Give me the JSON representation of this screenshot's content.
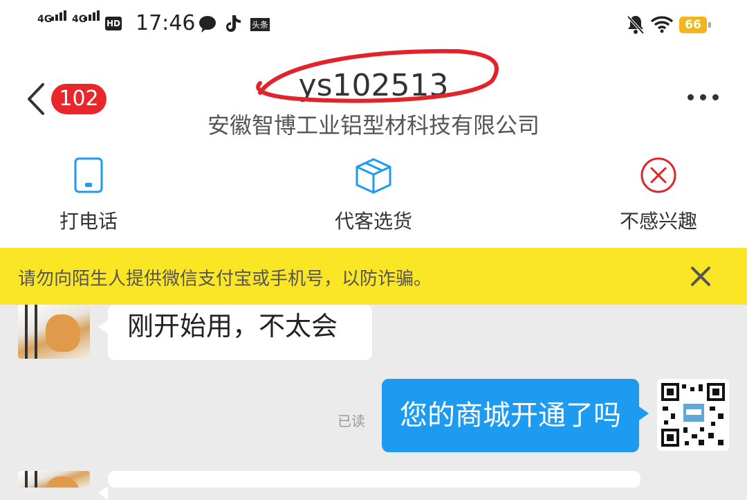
{
  "status_bar": {
    "signal1": "4G",
    "signal2": "4G",
    "hd": "HD",
    "time": "17:46",
    "app_tag": "头条",
    "battery": "66"
  },
  "header": {
    "unread_count": "102",
    "title": "ys102513",
    "subtitle": "安徽智博工业铝型材科技有限公司"
  },
  "actions": [
    {
      "label": "打电话",
      "icon": "phone-icon"
    },
    {
      "label": "代客选货",
      "icon": "box-icon"
    },
    {
      "label": "不感兴趣",
      "icon": "close-circle-icon"
    }
  ],
  "warning": {
    "text": "请勿向陌生人提供微信支付宝或手机号，以防诈骗。"
  },
  "messages": [
    {
      "side": "left",
      "text": "刚开始用，不太会"
    },
    {
      "side": "right",
      "text": "您的商城开通了吗",
      "status": "已读"
    },
    {
      "side": "left",
      "text": ""
    }
  ],
  "colors": {
    "accent_blue": "#1d9bf0",
    "badge_red": "#e8272c",
    "warning_yellow": "#fbe625",
    "annotation_red": "#e2232a"
  }
}
